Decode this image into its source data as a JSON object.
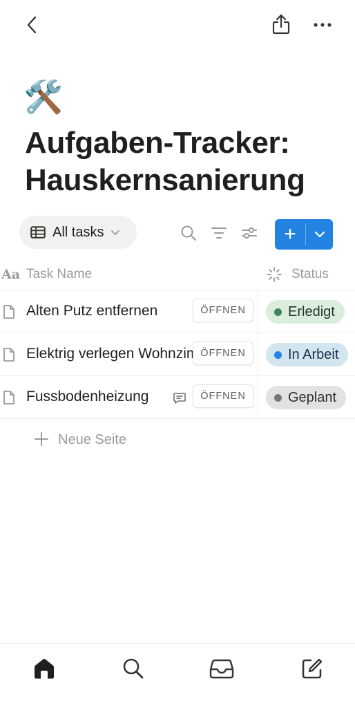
{
  "header": {
    "back_icon": "chevron-left-icon",
    "share_icon": "share-icon",
    "more_icon": "ellipsis-icon"
  },
  "page": {
    "emoji": "🛠️",
    "title": "Aufgaben-Tracker: Hauskernsanierung"
  },
  "toolbar": {
    "view_label": "All tasks",
    "new_label": "+"
  },
  "table": {
    "columns": {
      "name_prefix": "Aa",
      "name": "Task Name",
      "status": "Status"
    },
    "open_label": "ÖFFNEN",
    "rows": [
      {
        "name": "Alten Putz entfernen",
        "status": "Erledigt",
        "status_bg": "#dbeddb",
        "status_dot": "#448361",
        "has_comment": false
      },
      {
        "name": "Elektrig verlegen Wohnzimmer",
        "status": "In Arbeit",
        "status_bg": "#d3e5ef",
        "status_dot": "#2383e2",
        "has_comment": false
      },
      {
        "name": "Fussbodenheizung",
        "status": "Geplant",
        "status_bg": "#e3e2e0",
        "status_dot": "#787774",
        "has_comment": true
      }
    ],
    "new_page_label": "Neue Seite"
  },
  "bottom_nav": [
    "home-icon",
    "search-icon",
    "inbox-icon",
    "compose-icon"
  ],
  "colors": {
    "accent": "#2383e2",
    "text": "#1f1f1f",
    "muted": "#9b9a97"
  }
}
